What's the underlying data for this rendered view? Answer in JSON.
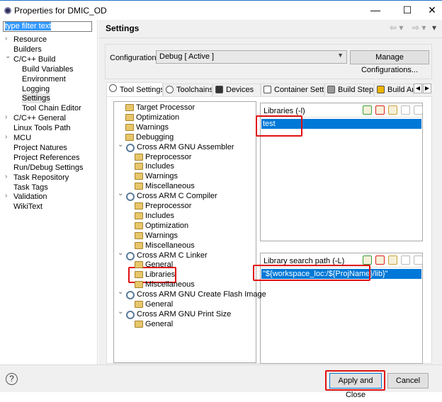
{
  "window": {
    "title": "Properties for DMIC_OD",
    "minimize": "—",
    "maximize": "☐",
    "close": "✕"
  },
  "filter": {
    "value": "type filter text"
  },
  "left_tree": [
    {
      "label": "Resource",
      "indent": 0,
      "chev": ">"
    },
    {
      "label": "Builders",
      "indent": 0
    },
    {
      "label": "C/C++ Build",
      "indent": 0,
      "chev": "v"
    },
    {
      "label": "Build Variables",
      "indent": 1
    },
    {
      "label": "Environment",
      "indent": 1
    },
    {
      "label": "Logging",
      "indent": 1
    },
    {
      "label": "Settings",
      "indent": 1,
      "selected": true
    },
    {
      "label": "Tool Chain Editor",
      "indent": 1
    },
    {
      "label": "C/C++ General",
      "indent": 0,
      "chev": ">"
    },
    {
      "label": "Linux Tools Path",
      "indent": 0
    },
    {
      "label": "MCU",
      "indent": 0,
      "chev": ">"
    },
    {
      "label": "Project Natures",
      "indent": 0
    },
    {
      "label": "Project References",
      "indent": 0
    },
    {
      "label": "Run/Debug Settings",
      "indent": 0
    },
    {
      "label": "Task Repository",
      "indent": 0,
      "chev": ">"
    },
    {
      "label": "Task Tags",
      "indent": 0
    },
    {
      "label": "Validation",
      "indent": 0,
      "chev": ">"
    },
    {
      "label": "WikiText",
      "indent": 0
    }
  ],
  "settings": {
    "title": "Settings",
    "nav_back": "⇦ ▾",
    "nav_fwd": "⇨ ▾",
    "menu": "▾"
  },
  "configuration": {
    "label": "Configuration:",
    "value": "Debug  [ Active ]",
    "manage_label": "Manage Configurations..."
  },
  "tabs": [
    {
      "label": "Tool Settings",
      "icon": "gear-icon",
      "active": true
    },
    {
      "label": "Toolchains",
      "icon": "gear-icon"
    },
    {
      "label": "Devices",
      "icon": "chip-icon"
    },
    {
      "label": "Container Settings",
      "icon": "container-icon"
    },
    {
      "label": "Build Steps",
      "icon": "hammer-icon"
    },
    {
      "label": "Build Ar",
      "icon": "trophy-icon"
    }
  ],
  "tool_tree": [
    {
      "label": "Target Processor",
      "level": 1,
      "type": "folder"
    },
    {
      "label": "Optimization",
      "level": 1,
      "type": "folder"
    },
    {
      "label": "Warnings",
      "level": 1,
      "type": "folder"
    },
    {
      "label": "Debugging",
      "level": 1,
      "type": "folder"
    },
    {
      "label": "Cross ARM GNU Assembler",
      "level": 0,
      "type": "tool"
    },
    {
      "label": "Preprocessor",
      "level": 2,
      "type": "folder"
    },
    {
      "label": "Includes",
      "level": 2,
      "type": "folder"
    },
    {
      "label": "Warnings",
      "level": 2,
      "type": "folder"
    },
    {
      "label": "Miscellaneous",
      "level": 2,
      "type": "folder"
    },
    {
      "label": "Cross ARM C Compiler",
      "level": 0,
      "type": "tool"
    },
    {
      "label": "Preprocessor",
      "level": 2,
      "type": "folder"
    },
    {
      "label": "Includes",
      "level": 2,
      "type": "folder"
    },
    {
      "label": "Optimization",
      "level": 2,
      "type": "folder"
    },
    {
      "label": "Warnings",
      "level": 2,
      "type": "folder"
    },
    {
      "label": "Miscellaneous",
      "level": 2,
      "type": "folder"
    },
    {
      "label": "Cross ARM C Linker",
      "level": 0,
      "type": "tool"
    },
    {
      "label": "General",
      "level": 2,
      "type": "folder"
    },
    {
      "label": "Libraries",
      "level": 2,
      "type": "folder",
      "selected": true
    },
    {
      "label": "Miscellaneous",
      "level": 2,
      "type": "folder"
    },
    {
      "label": "Cross ARM GNU Create Flash Image",
      "level": 0,
      "type": "tool"
    },
    {
      "label": "General",
      "level": 2,
      "type": "folder"
    },
    {
      "label": "Cross ARM GNU Print Size",
      "level": 0,
      "type": "tool"
    },
    {
      "label": "General",
      "level": 2,
      "type": "folder"
    }
  ],
  "libraries": {
    "header": "Libraries (-l)",
    "items": [
      "test"
    ]
  },
  "library_paths": {
    "header": "Library search path (-L)",
    "items": [
      "\"${workspace_loc:/${ProjName}/lib}\""
    ]
  },
  "toolbar_icons": [
    "add-icon",
    "delete-icon",
    "edit-icon",
    "move-up-icon",
    "move-down-icon"
  ],
  "footer": {
    "help": "?",
    "apply_label": "Apply and Close",
    "cancel_label": "Cancel"
  },
  "colors": {
    "selection": "#0078d7",
    "highlight": "#e01010"
  }
}
